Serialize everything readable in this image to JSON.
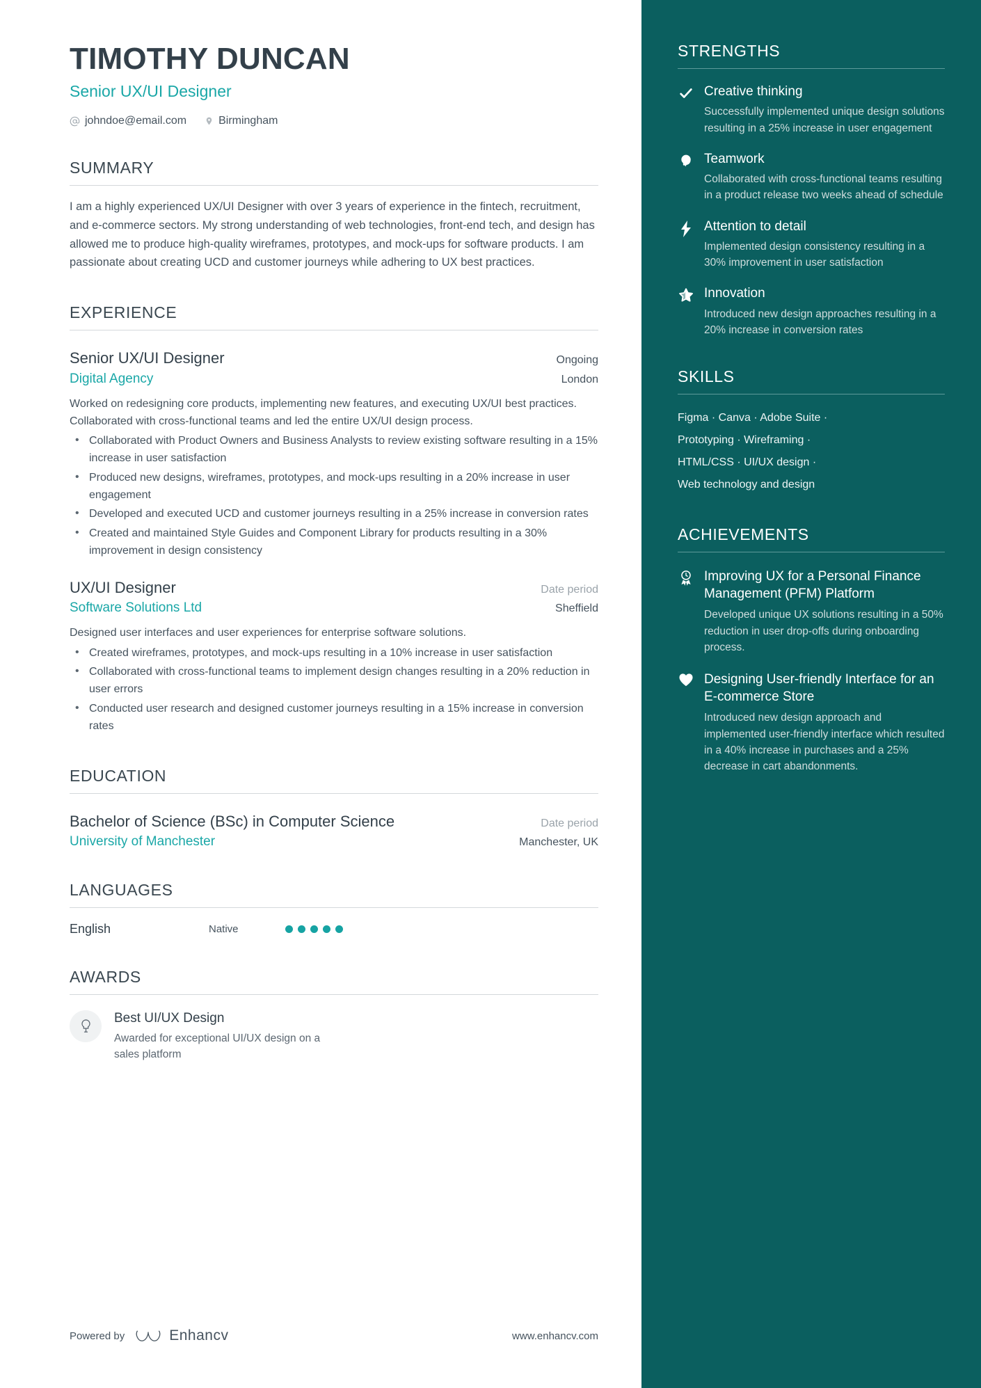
{
  "header": {
    "name": "TIMOTHY DUNCAN",
    "headline": "Senior UX/UI Designer",
    "email": "johndoe@email.com",
    "location": "Birmingham",
    "email_icon": "at-sign-icon",
    "location_icon": "map-pin-icon"
  },
  "summary": {
    "title": "SUMMARY",
    "text": "I am a highly experienced UX/UI Designer with over 3 years of experience in the fintech, recruitment, and e-commerce sectors. My strong understanding of web technologies, front-end tech, and design has allowed me to produce high-quality wireframes, prototypes, and mock-ups for software products. I am passionate about creating UCD and customer journeys while adhering to UX best practices."
  },
  "experience": {
    "title": "EXPERIENCE",
    "entries": [
      {
        "role": "Senior UX/UI Designer",
        "period": "Ongoing",
        "organization": "Digital Agency",
        "location": "London",
        "description": "Worked on redesigning core products, implementing new features, and executing UX/UI best practices. Collaborated with cross-functional teams and led the entire UX/UI design process.",
        "bullets": [
          "Collaborated with Product Owners and Business Analysts to review existing software resulting in a 15% increase in user satisfaction",
          "Produced new designs, wireframes, prototypes, and mock-ups resulting in a 20% increase in user engagement",
          "Developed and executed UCD and customer journeys resulting in a 25% increase in conversion rates",
          "Created and maintained Style Guides and Component Library for products resulting in a 30% improvement in design consistency"
        ]
      },
      {
        "role": "UX/UI Designer",
        "period": "Date period",
        "organization": "Software Solutions Ltd",
        "location": "Sheffield",
        "description": "Designed user interfaces and user experiences for enterprise software solutions.",
        "bullets": [
          "Created wireframes, prototypes, and mock-ups resulting in a 10% increase in user satisfaction",
          "Collaborated with cross-functional teams to implement design changes resulting in a 20% reduction in user errors",
          "Conducted user research and designed customer journeys resulting in a 15% increase in conversion rates"
        ]
      }
    ]
  },
  "education": {
    "title": "EDUCATION",
    "entries": [
      {
        "degree": "Bachelor of Science (BSc) in Computer Science",
        "period": "Date period",
        "school": "University of Manchester",
        "location": "Manchester, UK"
      }
    ]
  },
  "languages": {
    "title": "LANGUAGES",
    "items": [
      {
        "name": "English",
        "level": "Native",
        "dots_filled": 5,
        "dots_total": 5
      }
    ]
  },
  "awards": {
    "title": "AWARDS",
    "items": [
      {
        "icon": "lightbulb-icon",
        "title": "Best UI/UX Design",
        "description": "Awarded for exceptional UI/UX design on a sales platform"
      }
    ]
  },
  "strengths": {
    "title": "STRENGTHS",
    "items": [
      {
        "icon": "check-icon",
        "title": "Creative thinking",
        "description": "Successfully implemented unique design solutions resulting in a 25% increase in user engagement"
      },
      {
        "icon": "teamwork-icon",
        "title": "Teamwork",
        "description": "Collaborated with cross-functional teams resulting in a product release two weeks ahead of schedule"
      },
      {
        "icon": "lightning-bolt-icon",
        "title": "Attention to detail",
        "description": "Implemented design consistency resulting in a 30% improvement in user satisfaction"
      },
      {
        "icon": "star-icon",
        "title": "Innovation",
        "description": "Introduced new design approaches resulting in a 20% increase in conversion rates"
      }
    ]
  },
  "skills": {
    "title": "SKILLS",
    "lines": [
      "Figma · Canva · Adobe Suite ·",
      "Prototyping · Wireframing ·",
      "HTML/CSS · UI/UX design ·",
      "Web technology and design"
    ]
  },
  "achievements": {
    "title": "ACHIEVEMENTS",
    "items": [
      {
        "icon": "award-ribbon-icon",
        "title": "Improving UX for a Personal Finance Management (PFM) Platform",
        "description": "Developed unique UX solutions resulting in a 50% reduction in user drop-offs during onboarding process."
      },
      {
        "icon": "heart-icon",
        "title": "Designing User-friendly Interface for an E-commerce Store",
        "description": "Introduced new design approach and implemented user-friendly interface which resulted in a 40% increase in purchases and a 25% decrease in cart abandonments."
      }
    ]
  },
  "footer": {
    "powered_by": "Powered by",
    "brand": "Enhancv",
    "website": "www.enhancv.com"
  },
  "colors": {
    "accent_teal": "#1aa7a7",
    "sidebar_bg": "#0b5f5f",
    "heading": "#33404a",
    "body_text": "#46535e"
  }
}
